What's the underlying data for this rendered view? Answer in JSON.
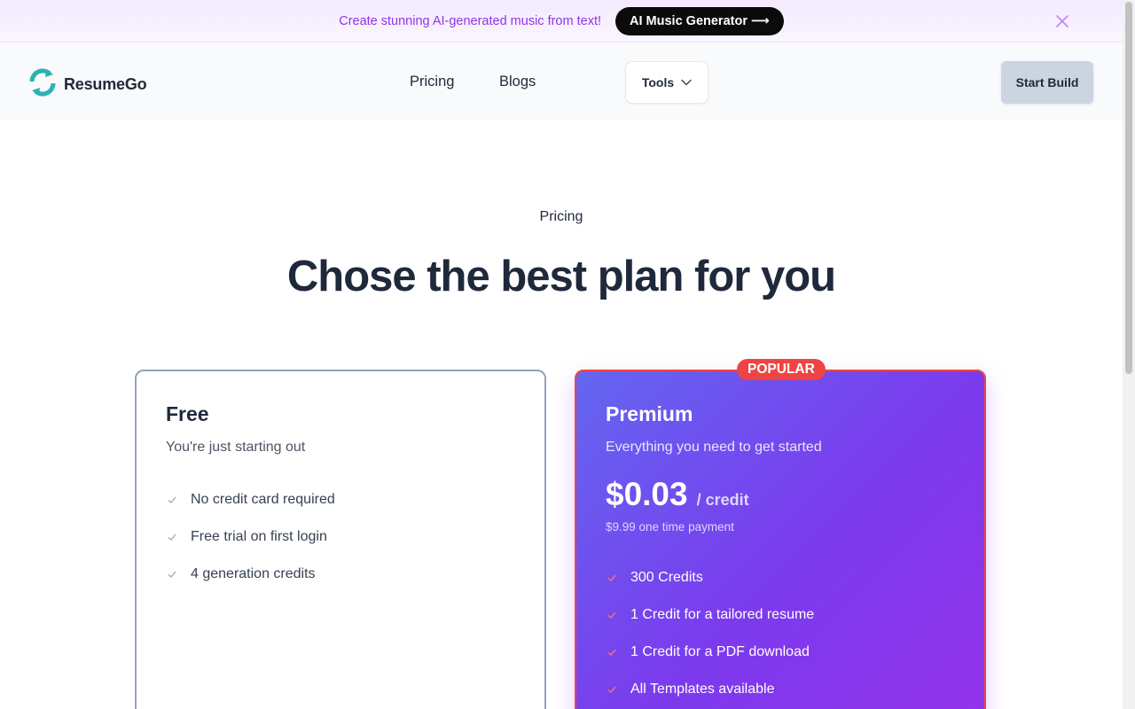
{
  "banner": {
    "text": "Create stunning AI-generated music from text!",
    "cta_label": "AI Music Generator",
    "cta_arrow": "⟶"
  },
  "navbar": {
    "logo_text": "ResumeGo",
    "links": [
      {
        "label": "Pricing"
      },
      {
        "label": "Blogs"
      }
    ],
    "tools_label": "Tools",
    "start_button_label": "Start Build"
  },
  "hero": {
    "eyebrow": "Pricing",
    "headline": "Chose the best plan for you"
  },
  "plans": [
    {
      "name": "Free",
      "description": "You're just starting out",
      "features": [
        "No credit card required",
        "Free trial on first login",
        "4 generation credits"
      ]
    },
    {
      "badge": "POPULAR",
      "name": "Premium",
      "description": "Everything you need to get started",
      "price": "$0.03",
      "price_unit": "/ credit",
      "price_note": "$9.99 one time payment",
      "features": [
        "300 Credits",
        "1 Credit for a tailored resume",
        "1 Credit for a PDF download",
        "All Templates available"
      ]
    }
  ],
  "colors": {
    "banner_text": "#9333ea",
    "premium_gradient_start": "#6366f1",
    "premium_gradient_end": "#9333ea",
    "popular_badge": "#ef4444",
    "logo_teal": "#2bb3b1"
  },
  "icons": [
    "close-icon",
    "refresh-logo-icon",
    "chevron-down-icon",
    "check-icon"
  ]
}
